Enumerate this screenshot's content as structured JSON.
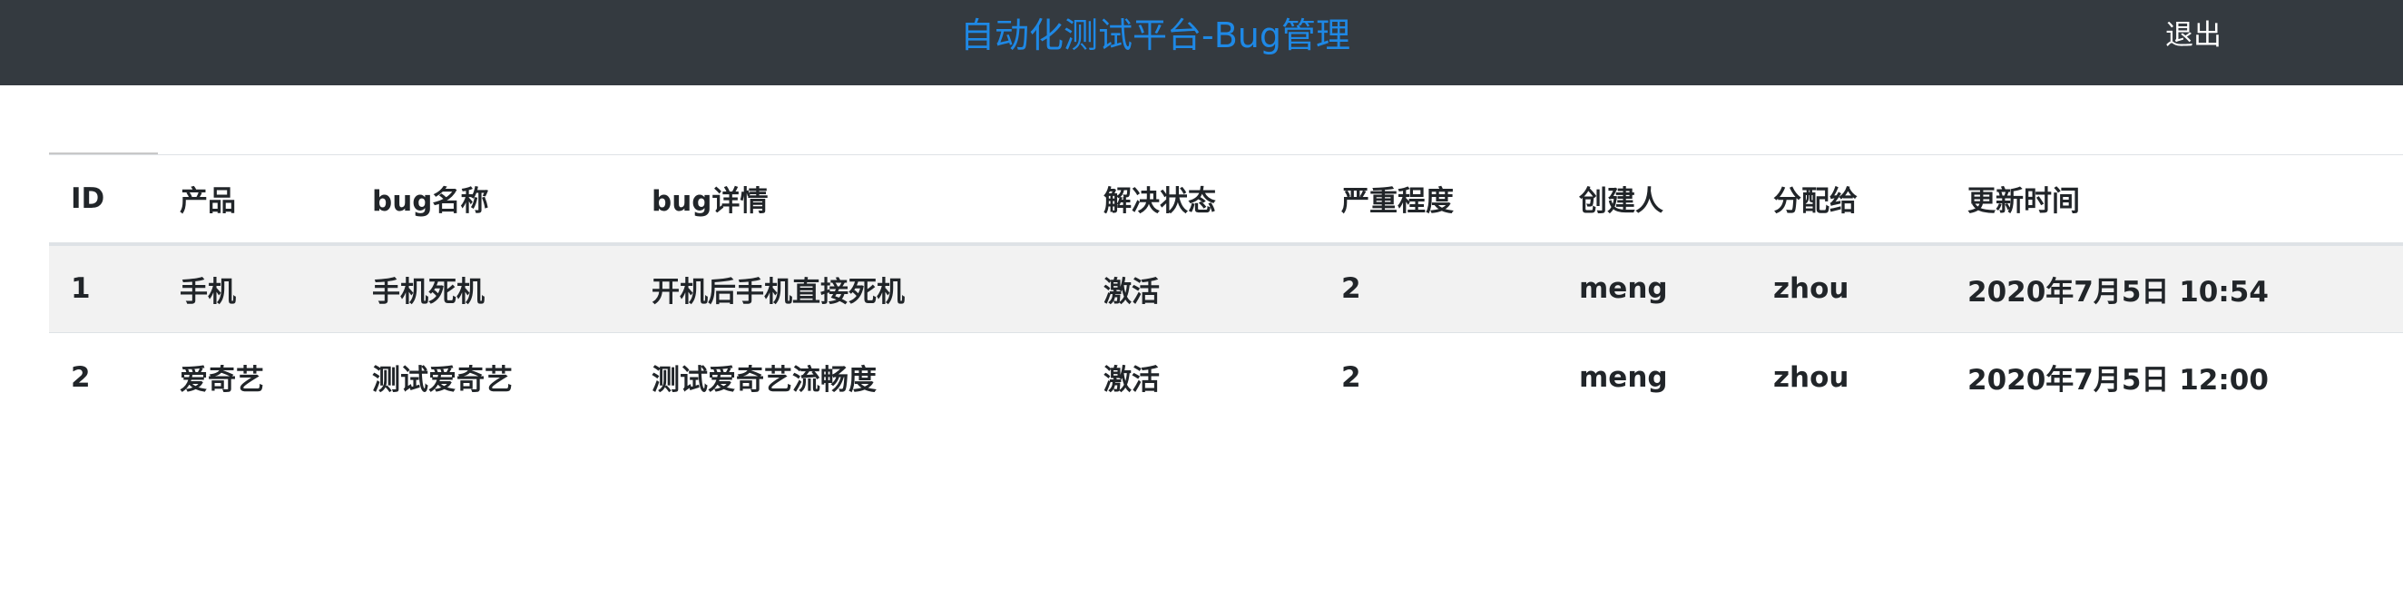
{
  "navbar": {
    "title": "自动化测试平台-Bug管理",
    "logout_label": "退出"
  },
  "table": {
    "headers": [
      "ID",
      "产品",
      "bug名称",
      "bug详情",
      "解决状态",
      "严重程度",
      "创建人",
      "分配给",
      "更新时间"
    ],
    "rows": [
      [
        "1",
        "手机",
        "手机死机",
        "开机后手机直接死机",
        "激活",
        "2",
        "meng",
        "zhou",
        "2020年7月5日 10:54"
      ],
      [
        "2",
        "爱奇艺",
        "测试爱奇艺",
        "测试爱奇艺流畅度",
        "激活",
        "2",
        "meng",
        "zhou",
        "2020年7月5日 12:00"
      ]
    ]
  },
  "colors": {
    "navbar_bg": "#343a40",
    "brand": "#1e88e5",
    "striped_row": "#f2f2f2"
  }
}
